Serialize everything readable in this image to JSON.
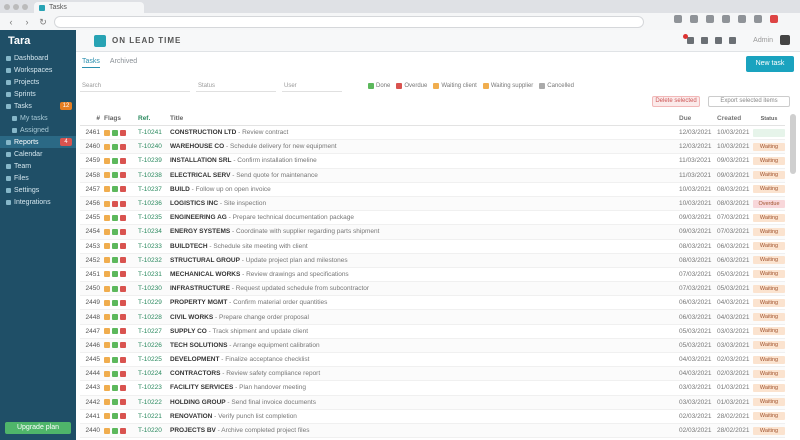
{
  "browser": {
    "tab_title": "Tasks",
    "url": "",
    "colors": {
      "favicon": "#28a3b4"
    }
  },
  "sidebar": {
    "logo": "Tara",
    "logo_sub": "",
    "items": [
      {
        "label": "Dashboard",
        "type": "main"
      },
      {
        "label": "Workspaces",
        "type": "main"
      },
      {
        "label": "Projects",
        "type": "main"
      },
      {
        "label": "Sprints",
        "type": "main"
      },
      {
        "label": "Tasks",
        "type": "main",
        "badge": "12",
        "badge_color": "#e67e22"
      },
      {
        "label": "My tasks",
        "type": "sub"
      },
      {
        "label": "Assigned",
        "type": "sub"
      },
      {
        "label": "Reports",
        "type": "main",
        "active": true,
        "badge": "4",
        "badge_color": "#d9534f"
      },
      {
        "label": "Calendar",
        "type": "main"
      },
      {
        "label": "Team",
        "type": "main"
      },
      {
        "label": "Files",
        "type": "main"
      },
      {
        "label": "Settings",
        "type": "main"
      },
      {
        "label": "Integrations",
        "type": "main"
      }
    ],
    "footer": "Upgrade plan"
  },
  "appbar": {
    "title": "ON LEAD TIME",
    "user": "Admin"
  },
  "content": {
    "tabs": [
      {
        "label": "Tasks",
        "active": true
      },
      {
        "label": "Archived",
        "active": false
      }
    ],
    "new_button": "New task",
    "filters": {
      "search_placeholder": "Search",
      "status_placeholder": "Status",
      "assignee_placeholder": "User"
    },
    "legend": [
      {
        "label": "Done",
        "color": "#5cb85c"
      },
      {
        "label": "Overdue",
        "color": "#d9534f"
      },
      {
        "label": "Waiting client",
        "color": "#f0ad4e"
      },
      {
        "label": "Waiting supplier",
        "color": "#f0ad4e"
      },
      {
        "label": "Cancelled",
        "color": "#aaaaaa"
      }
    ],
    "actions": {
      "delete": "Delete selected",
      "export": "Export selected items"
    },
    "columns": {
      "no": "#",
      "flags": "Flags",
      "ref": "Ref.",
      "title": "Title",
      "date": "Due",
      "date2": "Created",
      "status": "Status"
    },
    "rows": [
      {
        "no": "2461",
        "flags": [
          "#f0ad4e",
          "#5cb85c",
          "#d9534f"
        ],
        "ref": "T-10241",
        "name": "CONSTRUCTION LTD",
        "desc": "Review contract",
        "date": "12/03/2021",
        "date2": "10/03/2021",
        "status": "",
        "status_color": "#e6f4ea"
      },
      {
        "no": "2460",
        "flags": [
          "#f0ad4e",
          "#5cb85c",
          "#d9534f"
        ],
        "ref": "T-10240",
        "name": "WAREHOUSE CO",
        "desc": "Schedule delivery for new equipment",
        "date": "12/03/2021",
        "date2": "10/03/2021",
        "status": "Waiting",
        "status_color": "#fbe3cf"
      },
      {
        "no": "2459",
        "flags": [
          "#f0ad4e",
          "#5cb85c",
          "#d9534f"
        ],
        "ref": "T-10239",
        "name": "INSTALLATION SRL",
        "desc": "Confirm installation timeline",
        "date": "11/03/2021",
        "date2": "09/03/2021",
        "status": "Waiting",
        "status_color": "#fbe3cf"
      },
      {
        "no": "2458",
        "flags": [
          "#f0ad4e",
          "#5cb85c",
          "#d9534f"
        ],
        "ref": "T-10238",
        "name": "ELECTRICAL SERV",
        "desc": "Send quote for maintenance",
        "date": "11/03/2021",
        "date2": "09/03/2021",
        "status": "Waiting",
        "status_color": "#fbe3cf"
      },
      {
        "no": "2457",
        "flags": [
          "#f0ad4e",
          "#5cb85c",
          "#d9534f"
        ],
        "ref": "T-10237",
        "name": "BUILD",
        "desc": "Follow up on open invoice",
        "date": "10/03/2021",
        "date2": "08/03/2021",
        "status": "Waiting",
        "status_color": "#fbe3cf"
      },
      {
        "no": "2456",
        "flags": [
          "#f0ad4e",
          "#d9534f",
          "#d9534f"
        ],
        "ref": "T-10236",
        "name": "LOGISTICS INC",
        "desc": "Site inspection",
        "date": "10/03/2021",
        "date2": "08/03/2021",
        "status": "Overdue",
        "status_color": "#f8d7da"
      },
      {
        "no": "2455",
        "flags": [
          "#f0ad4e",
          "#5cb85c",
          "#d9534f"
        ],
        "ref": "T-10235",
        "name": "ENGINEERING AG",
        "desc": "Prepare technical documentation package",
        "date": "09/03/2021",
        "date2": "07/03/2021",
        "status": "Waiting",
        "status_color": "#fbe3cf"
      },
      {
        "no": "2454",
        "flags": [
          "#f0ad4e",
          "#5cb85c",
          "#d9534f"
        ],
        "ref": "T-10234",
        "name": "ENERGY SYSTEMS",
        "desc": "Coordinate with supplier regarding parts shipment",
        "date": "09/03/2021",
        "date2": "07/03/2021",
        "status": "Waiting",
        "status_color": "#fbe3cf"
      },
      {
        "no": "2453",
        "flags": [
          "#f0ad4e",
          "#5cb85c",
          "#d9534f"
        ],
        "ref": "T-10233",
        "name": "BUILDTECH",
        "desc": "Schedule site meeting with client",
        "date": "08/03/2021",
        "date2": "06/03/2021",
        "status": "Waiting",
        "status_color": "#fbe3cf"
      },
      {
        "no": "2452",
        "flags": [
          "#f0ad4e",
          "#5cb85c",
          "#d9534f"
        ],
        "ref": "T-10232",
        "name": "STRUCTURAL GROUP",
        "desc": "Update project plan and milestones",
        "date": "08/03/2021",
        "date2": "06/03/2021",
        "status": "Waiting",
        "status_color": "#fbe3cf"
      },
      {
        "no": "2451",
        "flags": [
          "#f0ad4e",
          "#5cb85c",
          "#d9534f"
        ],
        "ref": "T-10231",
        "name": "MECHANICAL WORKS",
        "desc": "Review drawings and specifications",
        "date": "07/03/2021",
        "date2": "05/03/2021",
        "status": "Waiting",
        "status_color": "#fbe3cf"
      },
      {
        "no": "2450",
        "flags": [
          "#f0ad4e",
          "#5cb85c",
          "#d9534f"
        ],
        "ref": "T-10230",
        "name": "INFRASTRUCTURE",
        "desc": "Request updated schedule from subcontractor",
        "date": "07/03/2021",
        "date2": "05/03/2021",
        "status": "Waiting",
        "status_color": "#fbe3cf"
      },
      {
        "no": "2449",
        "flags": [
          "#f0ad4e",
          "#5cb85c",
          "#d9534f"
        ],
        "ref": "T-10229",
        "name": "PROPERTY MGMT",
        "desc": "Confirm material order quantities",
        "date": "06/03/2021",
        "date2": "04/03/2021",
        "status": "Waiting",
        "status_color": "#fbe3cf"
      },
      {
        "no": "2448",
        "flags": [
          "#f0ad4e",
          "#5cb85c",
          "#d9534f"
        ],
        "ref": "T-10228",
        "name": "CIVIL WORKS",
        "desc": "Prepare change order proposal",
        "date": "06/03/2021",
        "date2": "04/03/2021",
        "status": "Waiting",
        "status_color": "#fbe3cf"
      },
      {
        "no": "2447",
        "flags": [
          "#f0ad4e",
          "#5cb85c",
          "#d9534f"
        ],
        "ref": "T-10227",
        "name": "SUPPLY CO",
        "desc": "Track shipment and update client",
        "date": "05/03/2021",
        "date2": "03/03/2021",
        "status": "Waiting",
        "status_color": "#fbe3cf"
      },
      {
        "no": "2446",
        "flags": [
          "#f0ad4e",
          "#5cb85c",
          "#d9534f"
        ],
        "ref": "T-10226",
        "name": "TECH SOLUTIONS",
        "desc": "Arrange equipment calibration",
        "date": "05/03/2021",
        "date2": "03/03/2021",
        "status": "Waiting",
        "status_color": "#fbe3cf"
      },
      {
        "no": "2445",
        "flags": [
          "#f0ad4e",
          "#5cb85c",
          "#d9534f"
        ],
        "ref": "T-10225",
        "name": "DEVELOPMENT",
        "desc": "Finalize acceptance checklist",
        "date": "04/03/2021",
        "date2": "02/03/2021",
        "status": "Waiting",
        "status_color": "#fbe3cf"
      },
      {
        "no": "2444",
        "flags": [
          "#f0ad4e",
          "#5cb85c",
          "#d9534f"
        ],
        "ref": "T-10224",
        "name": "CONTRACTORS",
        "desc": "Review safety compliance report",
        "date": "04/03/2021",
        "date2": "02/03/2021",
        "status": "Waiting",
        "status_color": "#fbe3cf"
      },
      {
        "no": "2443",
        "flags": [
          "#f0ad4e",
          "#5cb85c",
          "#d9534f"
        ],
        "ref": "T-10223",
        "name": "FACILITY SERVICES",
        "desc": "Plan handover meeting",
        "date": "03/03/2021",
        "date2": "01/03/2021",
        "status": "Waiting",
        "status_color": "#fbe3cf"
      },
      {
        "no": "2442",
        "flags": [
          "#f0ad4e",
          "#5cb85c",
          "#d9534f"
        ],
        "ref": "T-10222",
        "name": "HOLDING GROUP",
        "desc": "Send final invoice documents",
        "date": "03/03/2021",
        "date2": "01/03/2021",
        "status": "Waiting",
        "status_color": "#fbe3cf"
      },
      {
        "no": "2441",
        "flags": [
          "#f0ad4e",
          "#5cb85c",
          "#d9534f"
        ],
        "ref": "T-10221",
        "name": "RENOVATION",
        "desc": "Verify punch list completion",
        "date": "02/03/2021",
        "date2": "28/02/2021",
        "status": "Waiting",
        "status_color": "#fbe3cf"
      },
      {
        "no": "2440",
        "flags": [
          "#f0ad4e",
          "#5cb85c",
          "#d9534f"
        ],
        "ref": "T-10220",
        "name": "PROJECTS BV",
        "desc": "Archive completed project files",
        "date": "02/03/2021",
        "date2": "28/02/2021",
        "status": "Waiting",
        "status_color": "#fbe3cf"
      }
    ]
  }
}
